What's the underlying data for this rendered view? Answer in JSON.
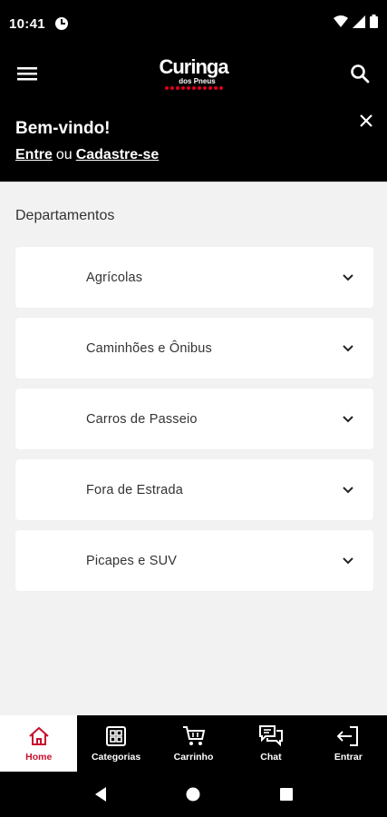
{
  "status_bar": {
    "time": "10:41"
  },
  "header": {
    "logo_main": "Curinga",
    "logo_sub": "dos Pneus"
  },
  "welcome": {
    "title": "Bem-vindo!",
    "login_link": "Entre",
    "or_text": "ou",
    "register_link": "Cadastre-se"
  },
  "departments": {
    "title": "Departamentos",
    "items": [
      {
        "label": "Agrícolas"
      },
      {
        "label": "Caminhões e Ônibus"
      },
      {
        "label": "Carros de Passeio"
      },
      {
        "label": "Fora de Estrada"
      },
      {
        "label": "Picapes e SUV"
      }
    ]
  },
  "bottom_nav": {
    "items": [
      {
        "label": "Home",
        "icon": "home-icon"
      },
      {
        "label": "Categorias",
        "icon": "categories-icon"
      },
      {
        "label": "Carrinho",
        "icon": "cart-icon"
      },
      {
        "label": "Chat",
        "icon": "chat-icon"
      },
      {
        "label": "Entrar",
        "icon": "login-icon"
      }
    ]
  },
  "colors": {
    "brand_red": "#c8102e",
    "header_bg": "#000000",
    "page_bg": "#f2f2f2"
  }
}
